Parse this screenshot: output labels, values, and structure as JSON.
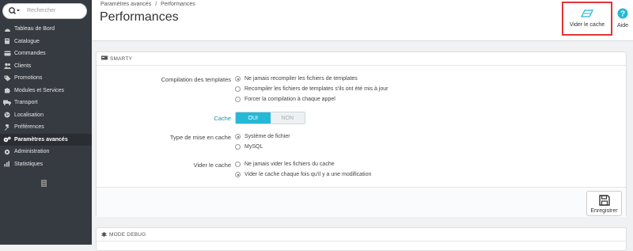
{
  "sidebar": {
    "search_placeholder": "Rechercher",
    "items": [
      {
        "label": "Tableau de Bord",
        "icon": "speedometer-icon"
      },
      {
        "label": "Catalogue",
        "icon": "book-icon"
      },
      {
        "label": "Commandes",
        "icon": "credit-card-icon"
      },
      {
        "label": "Clients",
        "icon": "users-icon"
      },
      {
        "label": "Promotions",
        "icon": "tag-icon"
      },
      {
        "label": "Modules et Services",
        "icon": "puzzle-icon"
      },
      {
        "label": "Transport",
        "icon": "truck-icon"
      },
      {
        "label": "Localisation",
        "icon": "globe-icon"
      },
      {
        "label": "Préférences",
        "icon": "wrench-icon"
      },
      {
        "label": "Paramètres avancés",
        "icon": "cogs-icon"
      },
      {
        "label": "Administration",
        "icon": "gear-icon"
      },
      {
        "label": "Statistiques",
        "icon": "bar-chart-icon"
      }
    ]
  },
  "header": {
    "breadcrumb": [
      "Paramètres avancés",
      "/",
      "Performances"
    ],
    "title": "Performances",
    "clear_cache_label": "Vider le cache",
    "help_label": "Aide"
  },
  "smarty": {
    "title": "SMARTY",
    "compile_label": "Compilation des templates",
    "compile_options": [
      "Ne jamais recompiler les fichiers de templates",
      "Recompiler les fichiers de templates s'ils ont été mis à jour",
      "Forcer la compilation à chaque appel"
    ],
    "cache_label": "Cache",
    "cache_yes": "OUI",
    "cache_no": "NON",
    "cache_type_label": "Type de mise en cache",
    "cache_type_options": [
      "Système de fichier",
      "MySQL"
    ],
    "clear_label": "Vider le cache",
    "clear_options": [
      "Ne jamais vider les fichiers du cache",
      "Vider le cache chaque fois qu'il y a une modification"
    ],
    "save_label": "Enregistrer"
  },
  "debug": {
    "title": "MODE DEBUG"
  },
  "colors": {
    "accent": "#25b9d7",
    "highlight_border": "#e2333a",
    "sidebar_bg": "#363a41"
  }
}
